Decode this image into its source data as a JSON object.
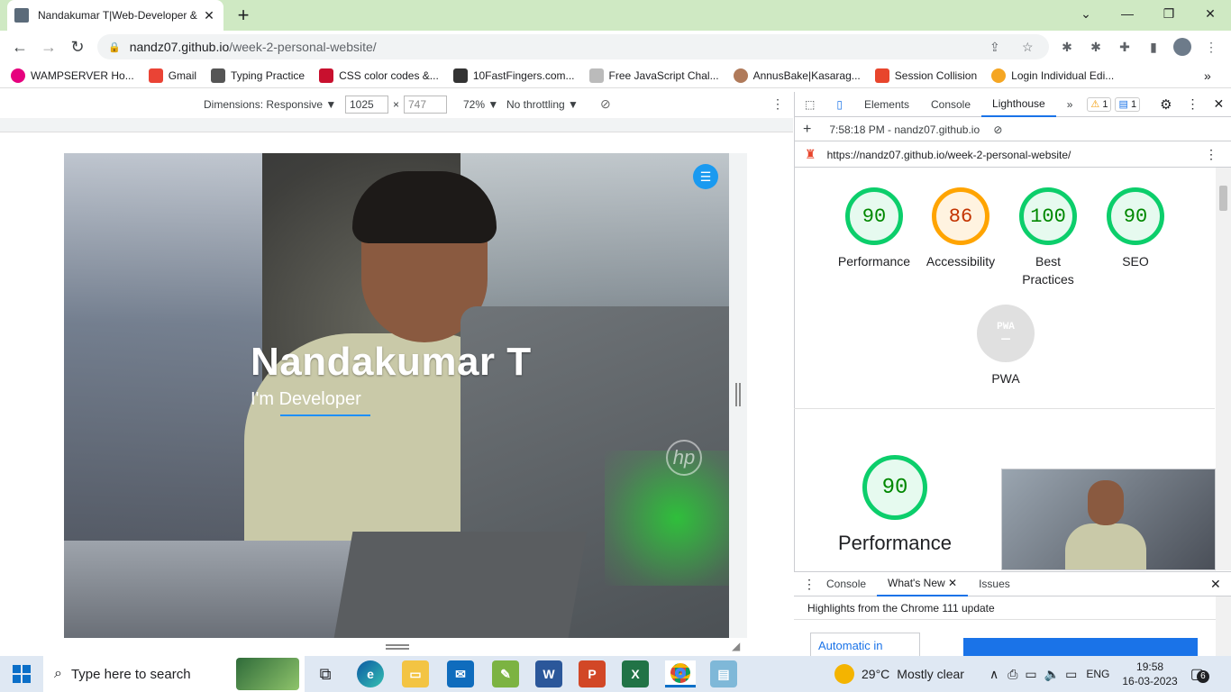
{
  "browser": {
    "tab_title": "Nandakumar T|Web-Developer &",
    "new_tab": "+",
    "tab_close": "✕",
    "window_controls": [
      "⌄",
      "—",
      "❐",
      "✕"
    ],
    "url_host": "nandz07.github.io",
    "url_path": "/week-2-personal-website/"
  },
  "bookmarks": [
    {
      "label": "WAMPSERVER Ho...",
      "color": "#e6007e"
    },
    {
      "label": "Gmail",
      "color": "#ea4335"
    },
    {
      "label": "Typing Practice",
      "color": "#555555"
    },
    {
      "label": "CSS color codes &...",
      "color": "#c8102e"
    },
    {
      "label": "10FastFingers.com...",
      "color": "#333333"
    },
    {
      "label": "Free JavaScript Chal...",
      "color": "#9e9e9e"
    },
    {
      "label": "AnnusBake|Kasarag...",
      "color": "#b07a5a"
    },
    {
      "label": "Session Collision",
      "color": "#e8452c"
    },
    {
      "label": "Login Individual Edi...",
      "color": "#f5a623"
    }
  ],
  "device_toolbar": {
    "dimensions_label": "Dimensions: Responsive ▼",
    "width": "1025",
    "times": "×",
    "height": "747",
    "zoom": "72% ▼",
    "throttle": "No throttling ▼"
  },
  "hero": {
    "name": "Nandakumar T",
    "subtitle": "I'm Developer",
    "logo_text": "hp"
  },
  "devtools": {
    "tabs": [
      "Elements",
      "Console",
      "Lighthouse"
    ],
    "active_tab": "Lighthouse",
    "more": "»",
    "warn_count": "1",
    "msg_count": "1",
    "report_time": "7:58:18 PM - nandz07.github.io ▼",
    "report_url": "https://nandz07.github.io/week-2-personal-website/",
    "scores": [
      {
        "value": "90",
        "label": "Performance",
        "status": "good"
      },
      {
        "value": "86",
        "label": "Accessibility",
        "status": "avg"
      },
      {
        "value": "100",
        "label": "Best Practices",
        "status": "good"
      },
      {
        "value": "90",
        "label": "SEO",
        "status": "good"
      }
    ],
    "pwa": {
      "label": "PWA",
      "badge": "PWA",
      "dash": "—"
    },
    "perf_detail": {
      "value": "90",
      "label": "Performance"
    }
  },
  "drawer": {
    "tabs": [
      "Console",
      "What's New",
      "Issues"
    ],
    "active_tab": "What's New",
    "highlight": "Highlights from the Chrome 111 update",
    "card_text": "Automatic in"
  },
  "taskbar": {
    "search_placeholder": "Type here to search",
    "weather_temp": "29°C",
    "weather_text": "Mostly clear",
    "lang": "ENG",
    "time": "19:58",
    "date": "16-03-2023",
    "notif_count": "6"
  },
  "colors": {
    "accent": "#1a73e8",
    "good": "#0cce6b",
    "average": "#ffa400"
  }
}
